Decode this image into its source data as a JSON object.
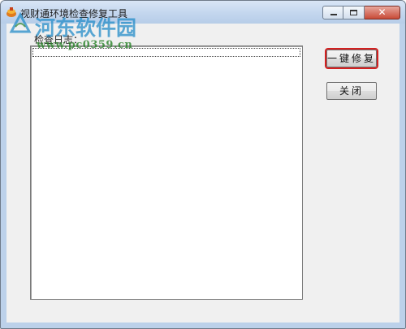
{
  "window": {
    "title": "视财通环境检查修复工具"
  },
  "main": {
    "log_label": "检查日志：",
    "log_content": ""
  },
  "buttons": {
    "repair_label": "一键修复",
    "close_label": "关闭"
  },
  "watermark": {
    "site_name": "河东软件园",
    "url": "www.pc0359.cn"
  },
  "colors": {
    "highlight_border": "#d42020",
    "watermark_blue": "#248cc8",
    "watermark_green": "#288228"
  },
  "icons": {
    "app": "app-icon",
    "minimize": "minimize-icon",
    "maximize": "maximize-icon",
    "close": "close-icon"
  }
}
